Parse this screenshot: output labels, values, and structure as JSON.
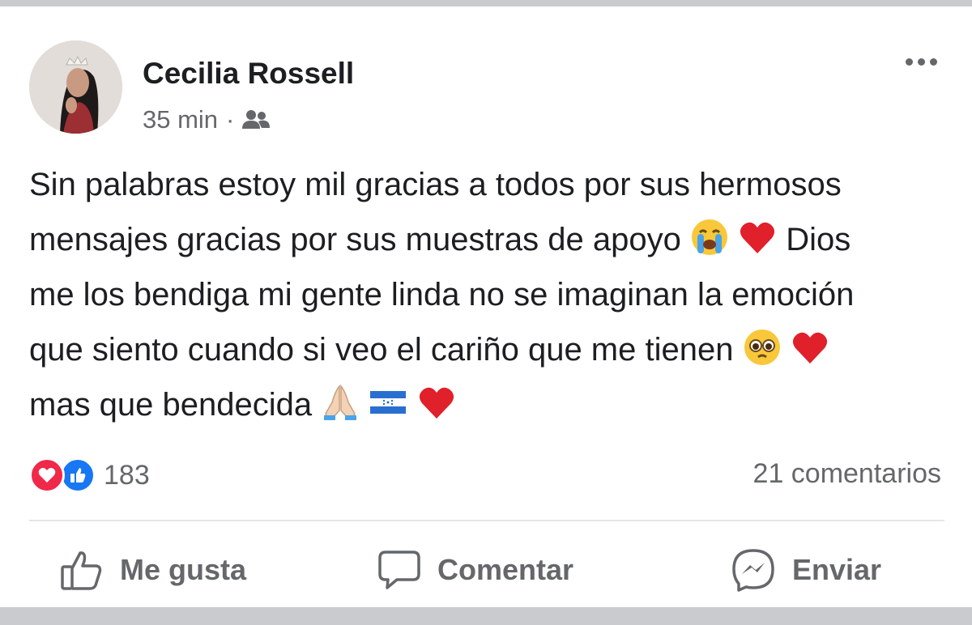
{
  "post": {
    "author": "Cecilia Rossell",
    "time": "35 min",
    "separator": "·",
    "audience_icon": "friends-icon",
    "lines": [
      "Sin palabras estoy mil gracias a todos por sus hermosos",
      "mensajes gracias por sus muestras de apoyo",
      "Dios",
      "me los bendiga mi gente linda no se imaginan la emoción",
      "que siento cuando si veo el cariño que me tienen",
      "mas que bendecida"
    ],
    "emojis": [
      "crying-face-emoji",
      "red-heart-emoji",
      "pleading-face-emoji",
      "red-heart-emoji",
      "folded-hands-emoji",
      "honduras-flag-emoji",
      "red-heart-emoji"
    ]
  },
  "stats": {
    "reaction_icons": [
      "love-reaction-icon",
      "like-reaction-icon"
    ],
    "reaction_count": "183",
    "comments": "21 comentarios"
  },
  "actions": {
    "like": "Me gusta",
    "comment": "Comentar",
    "send": "Enviar"
  },
  "colors": {
    "text": "#1c1e21",
    "secondary": "#65676b",
    "like_blue": "#1877f2",
    "love_red": "#f0284a"
  }
}
